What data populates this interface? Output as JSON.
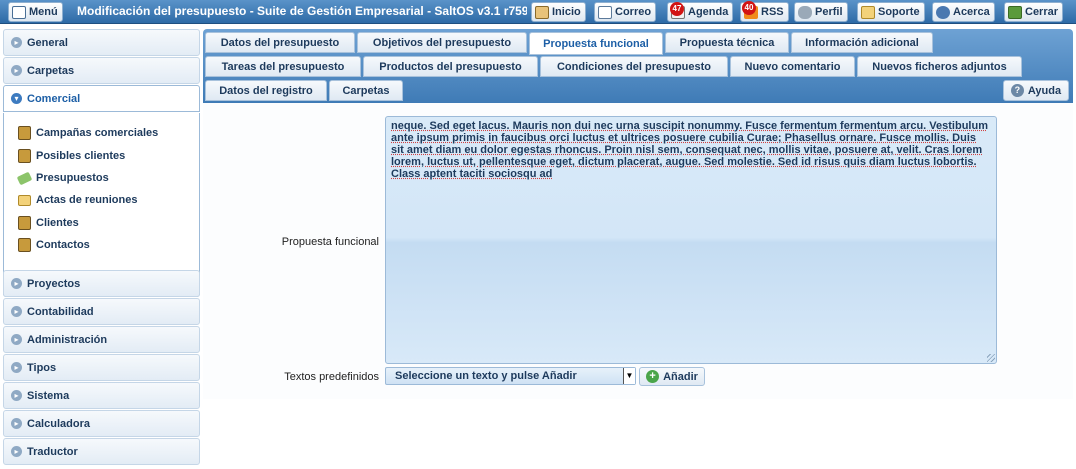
{
  "topbar": {
    "menu_label": "Menú",
    "title": "Modificación del presupuesto - Suite de Gestión Empresarial - SaltOS v3.1 r759.",
    "buttons": [
      {
        "label": "Inicio",
        "icon": "home-icon"
      },
      {
        "label": "Correo",
        "icon": "mail-icon"
      },
      {
        "label": "Agenda",
        "icon": "calendar-icon",
        "badge": "47"
      },
      {
        "label": "RSS",
        "icon": "rss-icon",
        "badge": "40"
      },
      {
        "label": "Perfil",
        "icon": "wrench-icon"
      },
      {
        "label": "Soporte",
        "icon": "support-icon"
      },
      {
        "label": "Acerca",
        "icon": "info-icon"
      },
      {
        "label": "Cerrar",
        "icon": "exit-icon"
      }
    ]
  },
  "sidebar": {
    "sections": [
      {
        "label": "General"
      },
      {
        "label": "Carpetas"
      },
      {
        "label": "Comercial"
      },
      {
        "label": "Proyectos"
      },
      {
        "label": "Contabilidad"
      },
      {
        "label": "Administración"
      },
      {
        "label": "Tipos"
      },
      {
        "label": "Sistema"
      },
      {
        "label": "Calculadora"
      },
      {
        "label": "Traductor"
      }
    ],
    "comercial_items": [
      {
        "label": "Campañas comerciales",
        "icon": "contacts-book-icon"
      },
      {
        "label": "Posibles clientes",
        "icon": "contacts-book-icon"
      },
      {
        "label": "Presupuestos",
        "icon": "money-icon"
      },
      {
        "label": "Actas de reuniones",
        "icon": "notes-icon"
      },
      {
        "label": "Clientes",
        "icon": "contacts-book-icon"
      },
      {
        "label": "Contactos",
        "icon": "contacts-book-icon"
      }
    ]
  },
  "tabs": {
    "row1": [
      "Datos del presupuesto",
      "Objetivos del presupuesto",
      "Propuesta funcional",
      "Propuesta técnica",
      "Información adicional"
    ],
    "row2": [
      "Tareas del presupuesto",
      "Productos del presupuesto",
      "Condiciones del presupuesto",
      "Nuevo comentario",
      "Nuevos ficheros adjuntos"
    ],
    "row3": [
      "Datos del registro",
      "Carpetas"
    ],
    "active": "Propuesta funcional",
    "help_label": "Ayuda"
  },
  "form": {
    "propuesta_label": "Propuesta funcional",
    "propuesta_text": "neque. Sed eget lacus. Mauris non dui nec urna suscipit nonummy. Fusce fermentum fermentum arcu. Vestibulum ante ipsum primis in faucibus orci luctus et ultrices posuere cubilia Curae; Phasellus ornare. Fusce mollis. Duis sit amet diam eu dolor egestas rhoncus. Proin nisl sem, consequat nec, mollis vitae, posuere at, velit. Cras lorem lorem, luctus ut, pellentesque eget, dictum placerat, augue. Sed molestie. Sed id risus quis diam luctus lobortis. Class aptent taciti sociosqu ad",
    "predef_label": "Textos predefinidos",
    "predef_selected": "Seleccione un texto y pulse Añadir",
    "add_label": "Añadir"
  }
}
